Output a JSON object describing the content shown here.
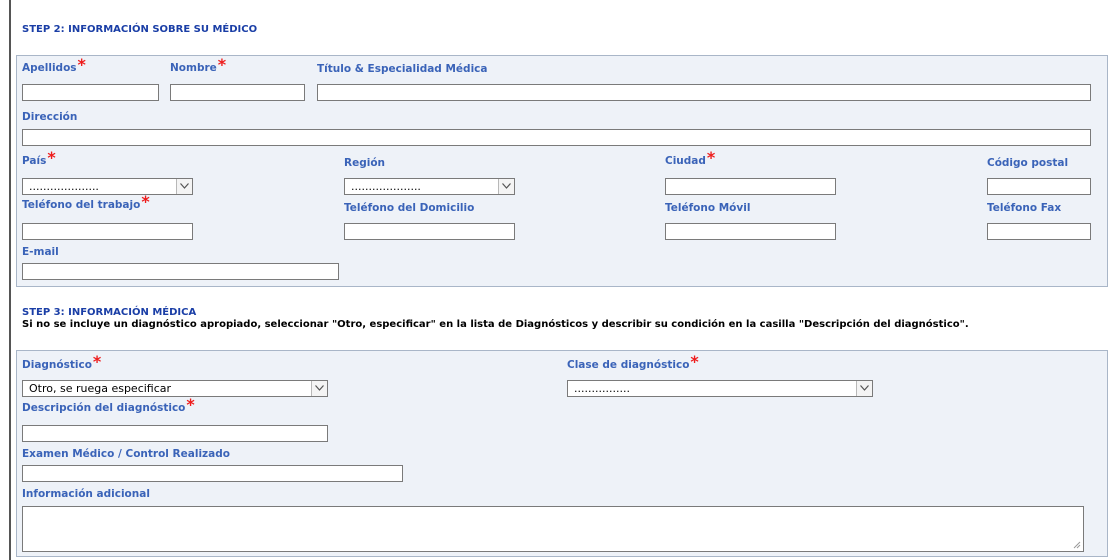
{
  "step2": {
    "title": "STEP 2: INFORMACIÓN SOBRE SU MÉDICO",
    "apellidos": "Apellidos",
    "nombre": "Nombre",
    "titulo": "Título & Especialidad Médica",
    "direccion": "Dirección",
    "pais": "País",
    "pais_value": "....................",
    "region": "Región",
    "region_value": "....................",
    "ciudad": "Ciudad",
    "codigo_postal": "Código postal",
    "tel_trabajo": "Teléfono del trabajo",
    "tel_domicilio": "Teléfono del Domicilio",
    "tel_movil": "Teléfono Móvil",
    "tel_fax": "Teléfono Fax",
    "email": "E-mail"
  },
  "step3": {
    "title": "STEP 3: INFORMACIÓN MÉDICA",
    "note": "Si no se incluye un diagnóstico apropiado, seleccionar \"Otro, especificar\" en la lista de Diagnósticos y describir su condición en la casilla \"Descripción del diagnóstico\".",
    "diagnostico": "Diagnóstico",
    "diagnostico_value": "Otro, se ruega especificar",
    "clase": "Clase de diagnóstico",
    "clase_value": "................",
    "descripcion": "Descripción del diagnóstico",
    "examen": "Examen Médico / Control Realizado",
    "info_adicional": "Información adicional"
  },
  "required_marker": "*",
  "colors": {
    "label": "#3a63b8",
    "title": "#1a3ea6",
    "required": "#ee1c1c",
    "panel": "#eef2f8"
  }
}
